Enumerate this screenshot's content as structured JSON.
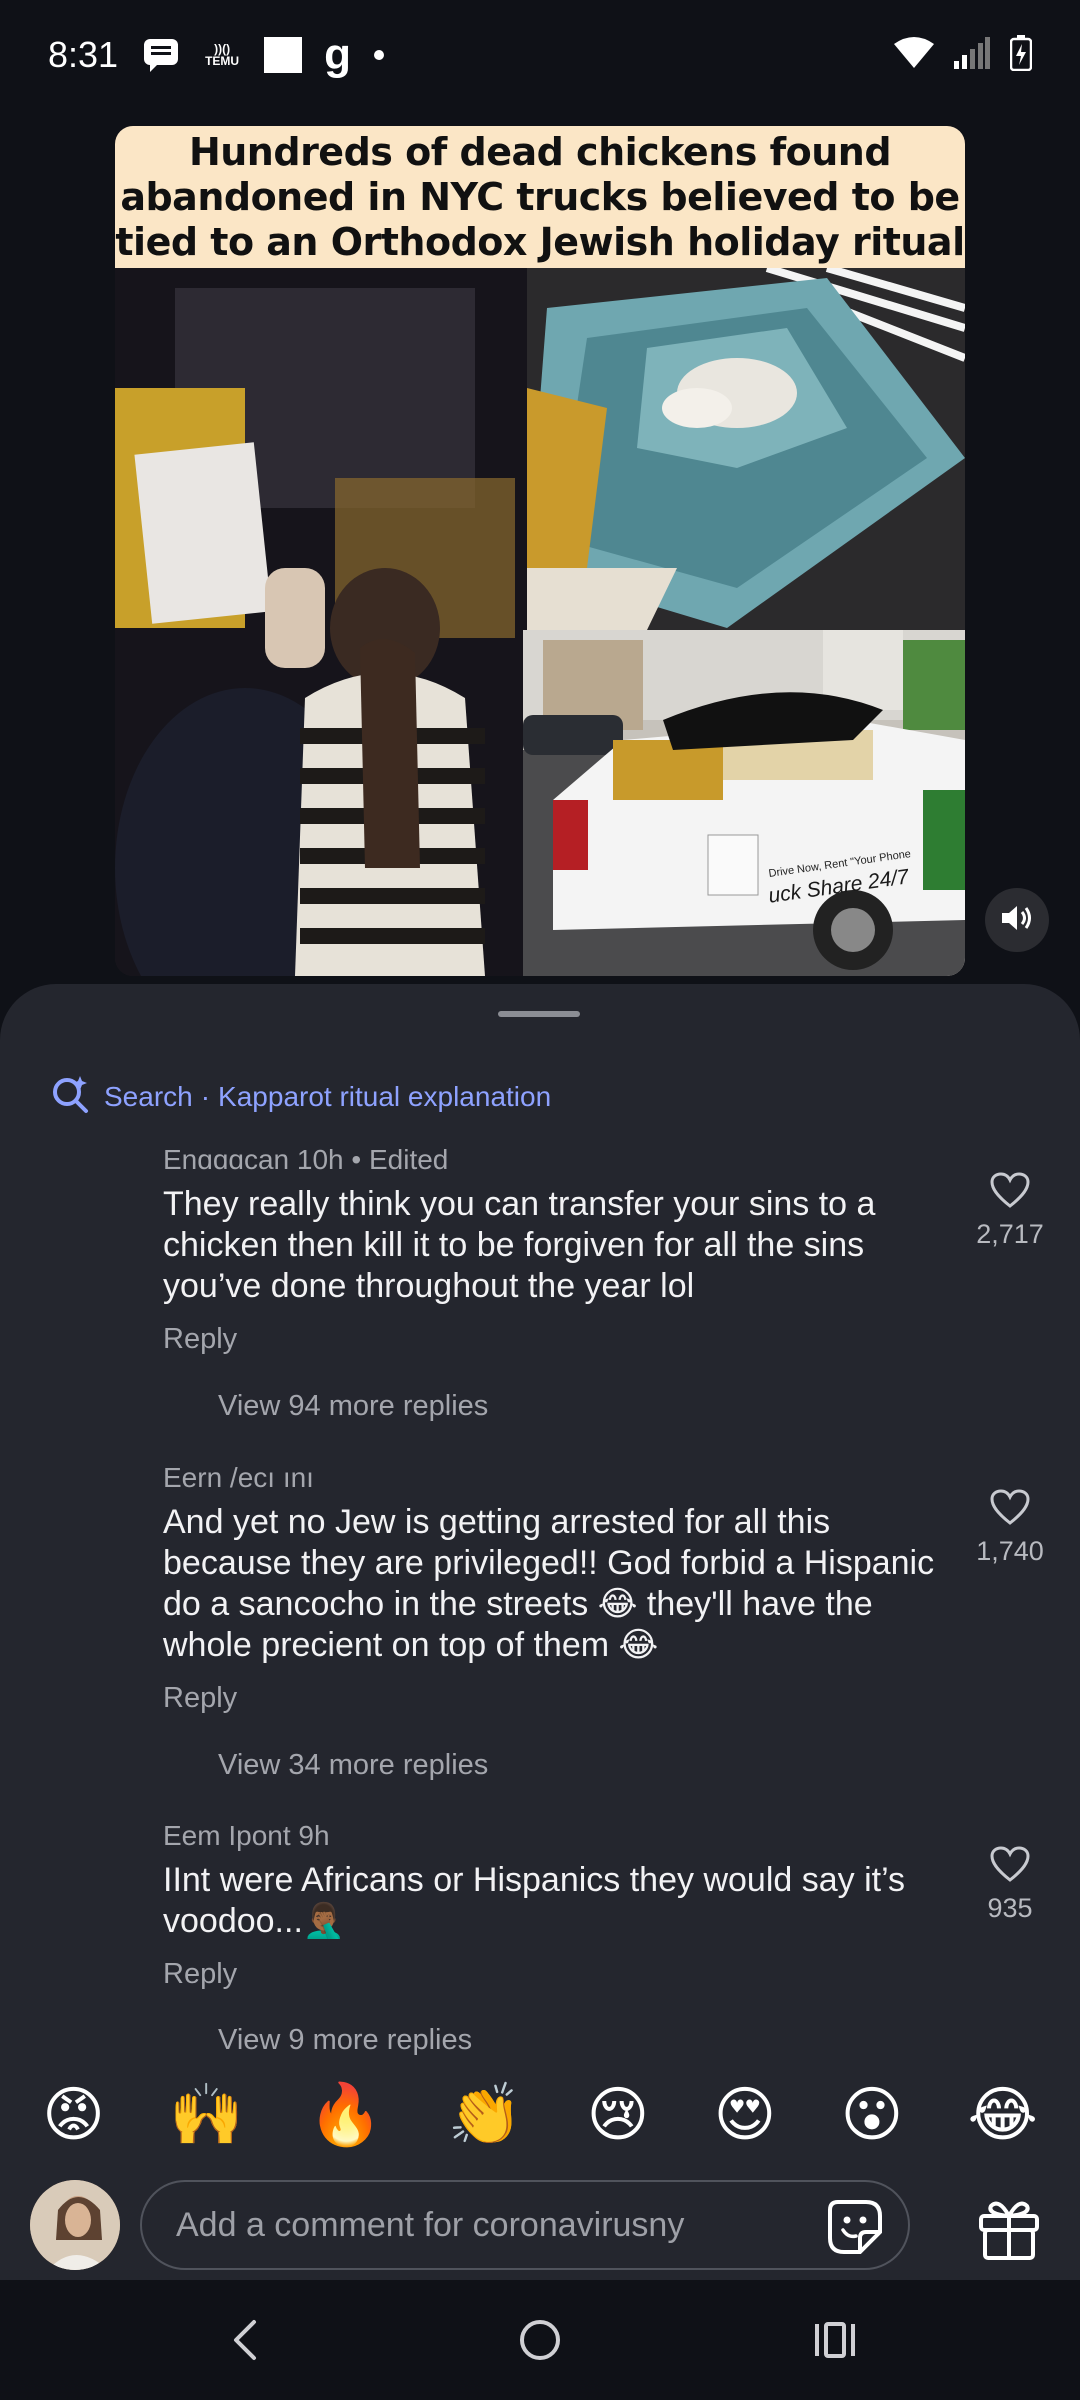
{
  "status_bar": {
    "time": "8:31",
    "icons": [
      "messages-icon",
      "temu-icon",
      "white-square-icon",
      "g-icon",
      "dot-icon",
      "wifi-icon",
      "signal-icon",
      "battery-charging-icon"
    ],
    "temu_label_top": "))()",
    "temu_label_bottom": "TEMU",
    "g_label": "g"
  },
  "post": {
    "headline_lines": [
      "Hundreds of dead chickens found",
      "abandoned in NYC trucks believed to be",
      "tied to an Orthodox Jewish holiday ritual"
    ],
    "truck_text": "uck Share 24/7",
    "truck_small_text": "Drive Now, Rent \"Your Phone",
    "sound_icon": "volume-icon"
  },
  "sheet": {
    "search_label": "Search",
    "search_separator": "·",
    "search_query": "Kapparot ritual explanation",
    "comments": [
      {
        "author": "Enɑɑɑcan",
        "meta": "10h • Edited",
        "body": "They really think you can transfer your sins to a chicken then kill it to be forgiven for all the sins you’ve done throughout the year lol",
        "reply": "Reply",
        "likes": "2,717",
        "view_more": "View 94 more replies"
      },
      {
        "author": "Eern /ecı ını",
        "meta": "",
        "body": "And yet no Jew is getting arrested for all this because they are privileged!! God forbid a Hispanic do a sancocho in the streets 😂 they'll have the whole precient on top of them 😂",
        "reply": "Reply",
        "likes": "1,740",
        "view_more": "View 34 more replies"
      },
      {
        "author": "Eem Ipont",
        "meta": "9h",
        "body": "IInt were Africans or Hispanics they would say it’s voodoo...🤦🏾‍♂️",
        "reply": "Reply",
        "likes": "935",
        "view_more": "View 9 more replies"
      }
    ]
  },
  "emoji_bar": [
    "😡",
    "🙌",
    "🔥",
    "👏",
    "😢",
    "😍",
    "😮",
    "😂"
  ],
  "composer": {
    "placeholder": "Add a comment for coronavirusny",
    "sticker_icon": "sticker-icon",
    "gift_icon": "gift-icon"
  },
  "nav_bar": {
    "icons": [
      "back-icon",
      "home-icon",
      "recents-icon"
    ]
  },
  "colors": {
    "background": "#0f1117",
    "sheet": "#24262e",
    "search_accent": "#8ea2ff",
    "headline_bg": "#fbe6c6"
  }
}
